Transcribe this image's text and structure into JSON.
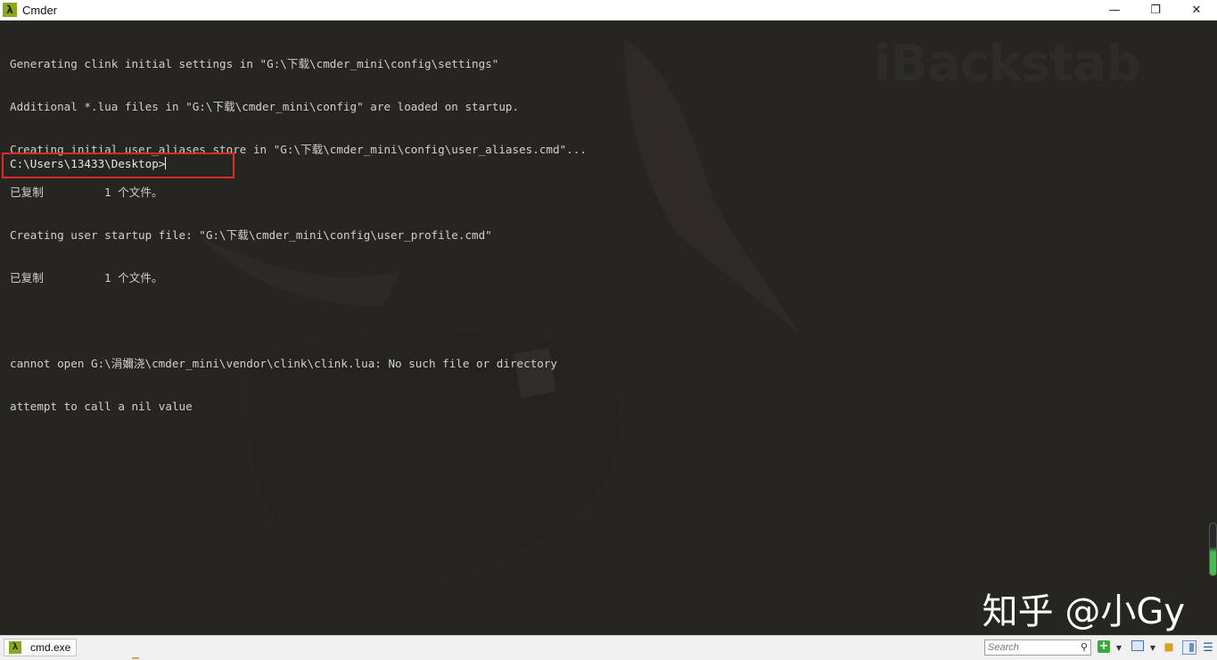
{
  "window": {
    "title": "Cmder",
    "app_icon": "lambda-icon",
    "controls": {
      "minimize": "—",
      "restore": "❐",
      "close": "✕"
    }
  },
  "console": {
    "lines": [
      "Generating clink initial settings in \"G:\\下载\\cmder_mini\\config\\settings\"",
      "Additional *.lua files in \"G:\\下载\\cmder_mini\\config\" are loaded on startup.",
      "Creating initial user_aliases store in \"G:\\下载\\cmder_mini\\config\\user_aliases.cmd\"...",
      "已复制         1 个文件。",
      "Creating user startup file: \"G:\\下载\\cmder_mini\\config\\user_profile.cmd\"",
      "已复制         1 个文件。",
      "",
      "cannot open G:\\涓嬭浇\\cmder_mini\\vendor\\clink\\clink.lua: No such file or directory",
      "attempt to call a nil value"
    ],
    "prompt": "C:\\Users\\13433\\Desktop>",
    "watermark": "iBackstab",
    "highlight_color": "#e02a2a"
  },
  "overlay_watermark": "知乎 @小Gy",
  "statusbar": {
    "tab_label": "cmd.exe",
    "search_placeholder": "Search",
    "search_icon": "magnifier-icon",
    "new_console_icon": "plus-icon",
    "dropdown_glyph": "▼",
    "lock_glyph": "🔒",
    "menu_glyph": "☰"
  }
}
